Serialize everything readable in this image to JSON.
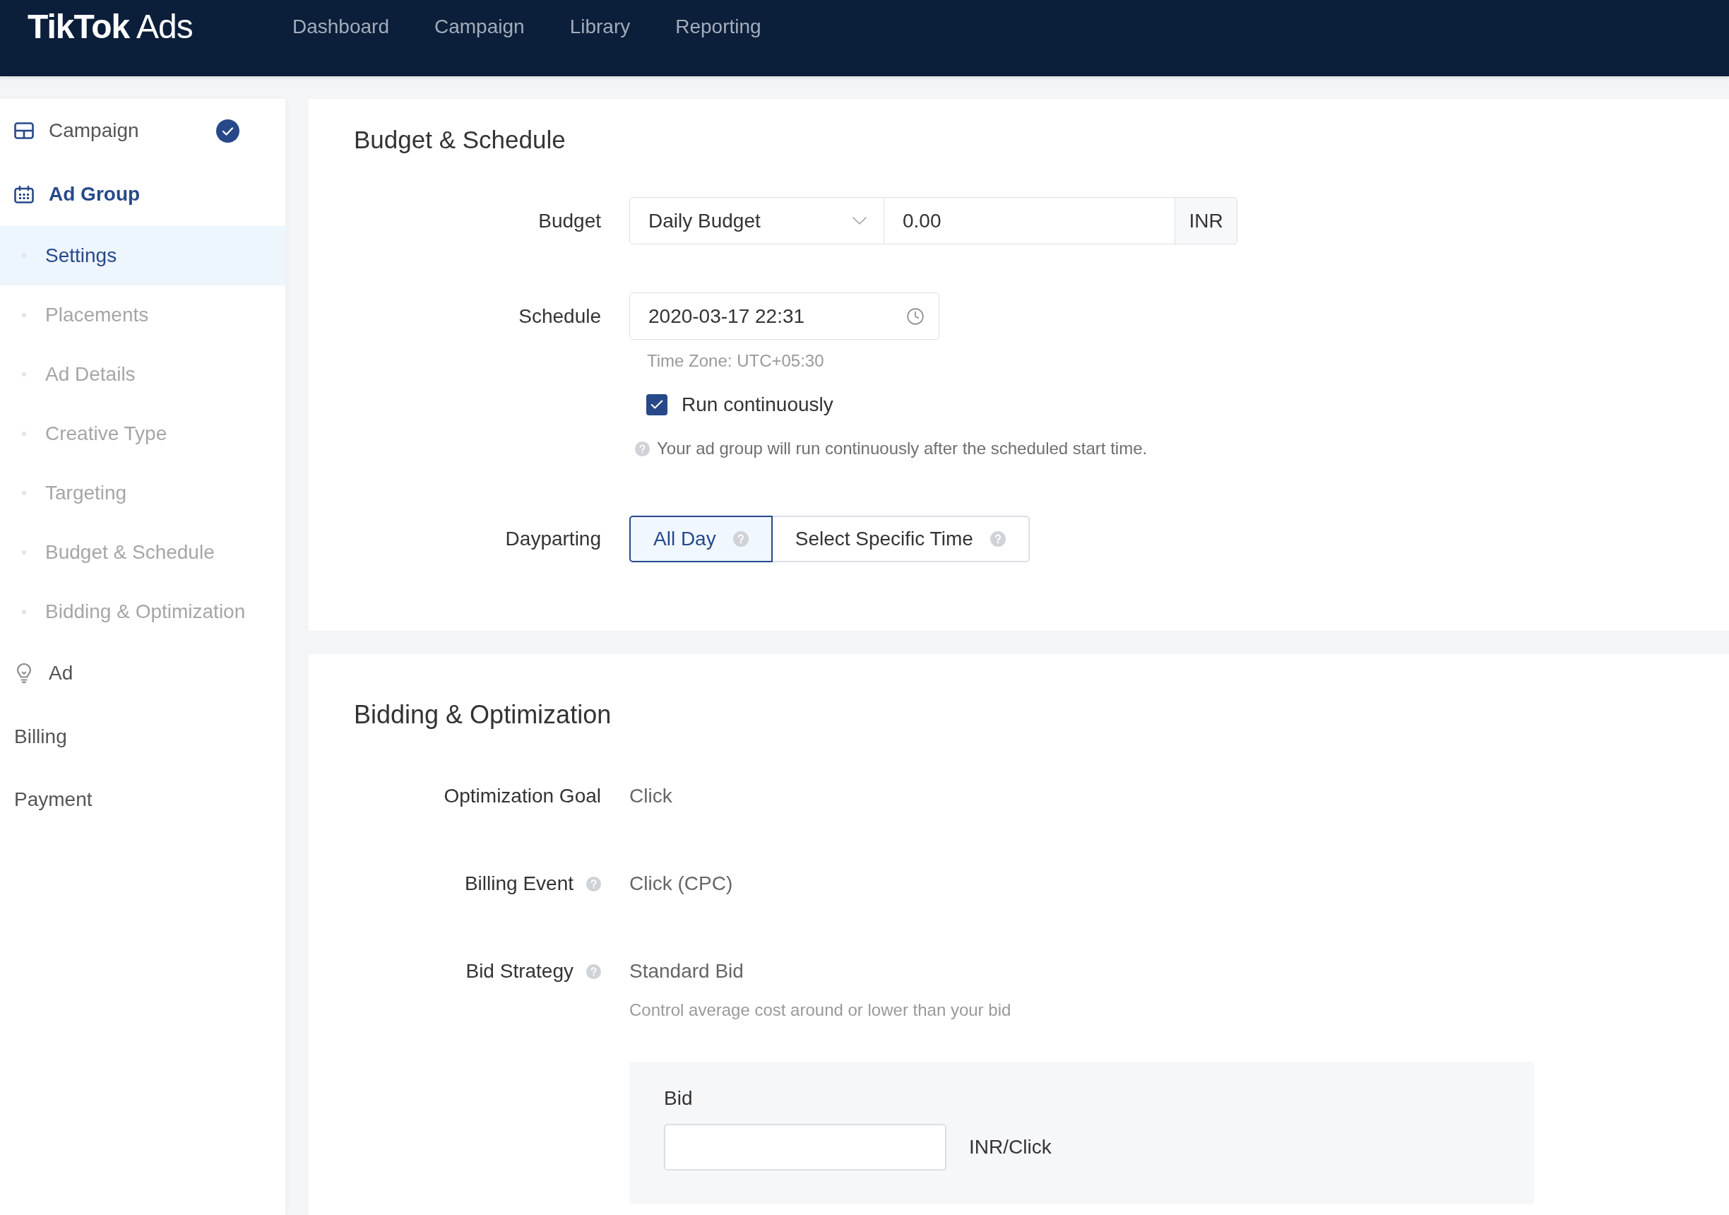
{
  "nav": {
    "logo": "**TikTok** Ads",
    "items": [
      {
        "label": "Dashboard",
        "selected": false
      },
      {
        "label": "Campaign",
        "selected": false
      },
      {
        "label": "Library",
        "selected": false
      },
      {
        "label": "Reporting",
        "selected": false
      }
    ]
  },
  "sidebar": {
    "items": [
      {
        "label": "Campaign",
        "kind": "step",
        "done": true,
        "active": false
      },
      {
        "label": "Ad Group",
        "kind": "step",
        "done": false,
        "active": true,
        "children": [
          {
            "label": "Settings",
            "selected": true
          },
          {
            "label": "Placements",
            "selected": false
          },
          {
            "label": "Ad Details",
            "selected": false
          },
          {
            "label": "Creative Type",
            "selected": false
          },
          {
            "label": "Targeting",
            "selected": false
          },
          {
            "label": "Budget & Schedule",
            "selected": false
          },
          {
            "label": "Bidding & Optimization",
            "selected": false
          }
        ]
      },
      {
        "label": "Ad",
        "kind": "step",
        "done": false,
        "active": false
      },
      {
        "label": "Billing",
        "kind": "link"
      },
      {
        "label": "Payment",
        "kind": "link"
      }
    ]
  },
  "budget_schedule": {
    "title": "Budget & Schedule",
    "budget": {
      "label": "Budget",
      "type_select": {
        "value": "Daily Budget"
      },
      "amount": {
        "value": "0.00"
      },
      "currency": "INR"
    },
    "schedule": {
      "label": "Schedule",
      "value": "2020-03-17 22:31",
      "time_zone": "Time Zone: UTC+05:30",
      "run_continuously": {
        "label": "Run continuously",
        "checked": true
      },
      "help": "Your ad group will run continuously after the scheduled start time."
    },
    "dayparting": {
      "label": "Dayparting",
      "options": [
        {
          "label": "All Day",
          "selected": true
        },
        {
          "label": "Select Specific Time",
          "selected": false
        }
      ]
    }
  },
  "bidding_optimization": {
    "title": "Bidding & Optimization",
    "fields": [
      {
        "label": "Optimization Goal",
        "value": "Click",
        "help": false
      },
      {
        "label": "Billing Event",
        "value": "Click (CPC)",
        "help": true
      },
      {
        "label": "Bid Strategy",
        "value": "Standard Bid",
        "help": true,
        "description": "Control average cost around or lower than your bid"
      }
    ],
    "bid": {
      "label": "Bid",
      "unit": "INR/Click"
    }
  }
}
